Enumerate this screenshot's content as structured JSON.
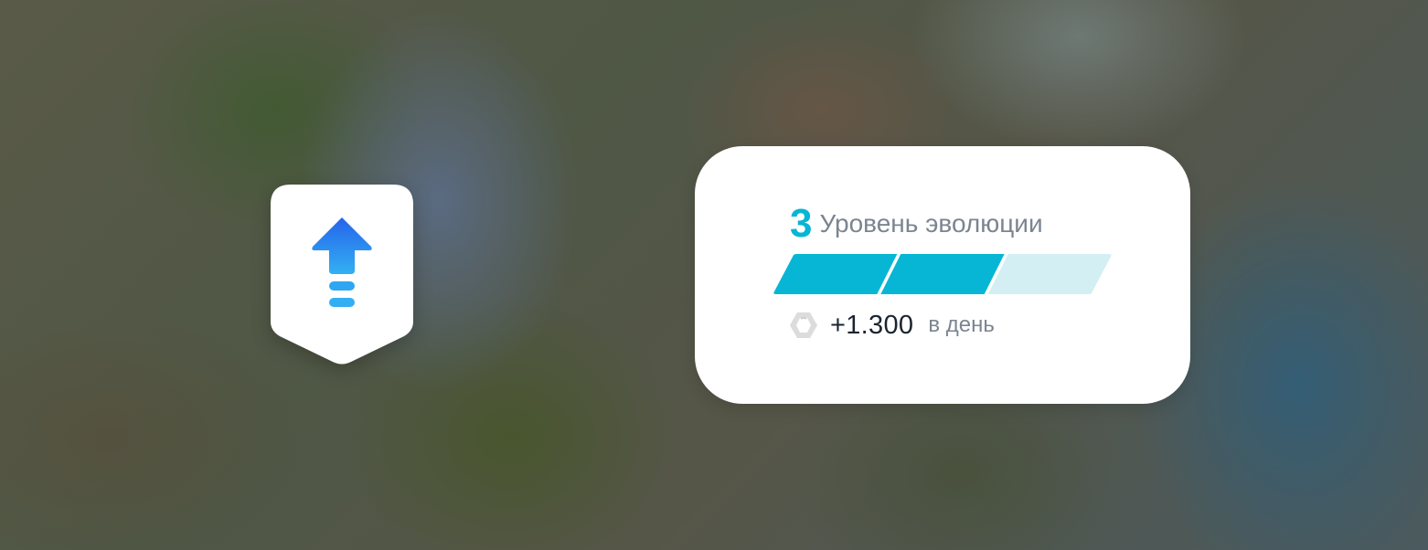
{
  "evolution": {
    "level": "3",
    "title": "Уровень эволюции",
    "progress": {
      "segments_total": 3,
      "segments_filled": 2
    },
    "income": {
      "value": "+1.300",
      "unit": "в день",
      "icon": "coin-icon"
    }
  },
  "upgrade_badge": {
    "icon": "upgrade-arrow-icon"
  },
  "colors": {
    "accent": "#06b6d4",
    "progress_empty": "#d4eff3",
    "arrow_top": "#2563eb",
    "arrow_bottom": "#29a8f0",
    "muted_text": "#7b8590",
    "value_text": "#1b2430"
  }
}
